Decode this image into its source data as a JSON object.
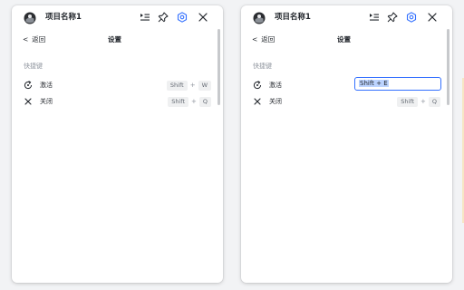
{
  "panels": [
    {
      "header": {
        "project_title": "项目名称1"
      },
      "subheader": {
        "back_label": "返回",
        "title": "设置"
      },
      "section_label": "快捷键",
      "shortcuts": [
        {
          "label": "激活",
          "keys": [
            "Shift",
            "W"
          ]
        },
        {
          "label": "关闭",
          "keys": [
            "Shift",
            "Q"
          ]
        }
      ]
    },
    {
      "header": {
        "project_title": "项目名称1"
      },
      "subheader": {
        "back_label": "返回",
        "title": "设置"
      },
      "section_label": "快捷键",
      "shortcuts": [
        {
          "label": "激活",
          "input_value": "Shift + E",
          "editing": true
        },
        {
          "label": "关闭",
          "keys": [
            "Shift",
            "Q"
          ]
        }
      ]
    }
  ],
  "plus_symbol": "+",
  "icons": {
    "logo": "avatar-logo-icon",
    "header": [
      "list-play-icon",
      "pin-icon",
      "gear-icon",
      "close-icon"
    ],
    "activate": "activate-refresh-icon",
    "close": "close-x-icon",
    "back": "chevron-left-icon"
  },
  "colors": {
    "accent": "#3370ff",
    "text": "#1f2329",
    "muted": "#8f959e",
    "key_bg": "#eff0f1",
    "selection": "#bcd4ff"
  }
}
